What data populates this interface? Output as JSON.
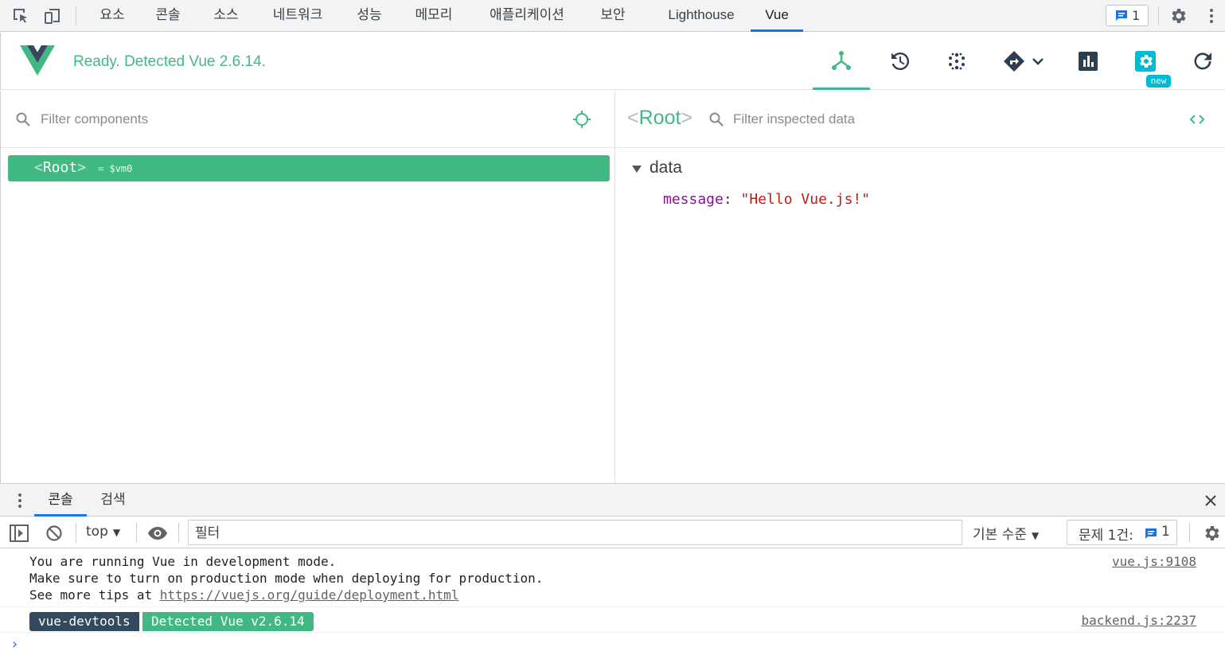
{
  "devtools": {
    "tabs": [
      "요소",
      "콘솔",
      "소스",
      "네트워크",
      "성능",
      "메모리",
      "애플리케이션",
      "보안",
      "Lighthouse",
      "Vue"
    ],
    "active_tab": "Vue",
    "issues_count": "1"
  },
  "vue_header": {
    "status": "Ready. Detected Vue 2.6.14.",
    "new_badge": "new",
    "brand_color": "#42b983"
  },
  "components": {
    "filter_placeholder": "Filter components",
    "tree": [
      {
        "name": "Root",
        "ref": "= $vm0",
        "selected": true
      }
    ]
  },
  "inspector": {
    "component_name": "Root",
    "filter_placeholder": "Filter inspected data",
    "section_title": "data",
    "props": [
      {
        "key": "message",
        "value": "\"Hello Vue.js!\""
      }
    ]
  },
  "drawer": {
    "tabs": [
      "콘솔",
      "검색"
    ],
    "active_tab": "콘솔"
  },
  "console": {
    "context": "top",
    "filter_placeholder": "필터",
    "level": "기본 수준",
    "issues_label": "문제 1건:",
    "issues_count": "1",
    "messages": [
      {
        "lines": [
          "You are running Vue in development mode.",
          "Make sure to turn on production mode when deploying for production.",
          "See more tips at "
        ],
        "link": "https://vuejs.org/guide/deployment.html",
        "source": "vue.js:9108"
      },
      {
        "badge_left": "vue-devtools",
        "badge_right": "Detected Vue v2.6.14",
        "source": "backend.js:2237"
      }
    ],
    "prompt": "›"
  }
}
